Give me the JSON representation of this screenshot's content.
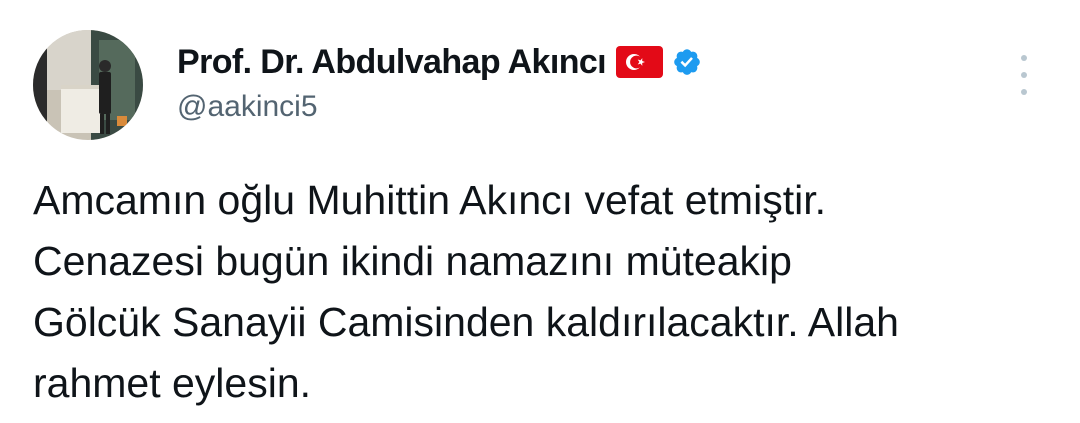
{
  "author": {
    "display_name": "Prof. Dr. Abdulvahap Akıncı",
    "handle": "@aakinci5",
    "flag_icon": "turkey-flag-icon",
    "verified_icon": "verified-badge-icon",
    "verified_color": "#1d9bf0",
    "flag_color": "#e30a17"
  },
  "menu": {
    "icon": "more-options-icon"
  },
  "tweet": {
    "lines": [
      "Amcamın oğlu Muhittin Akıncı vefat etmiştir.",
      "Cenazesi bugün ikindi namazını müteakip",
      "Gölcük Sanayii Camisinden kaldırılacaktır. Allah",
      "rahmet eylesin."
    ]
  },
  "colors": {
    "text": "#0f1419",
    "secondary_text": "#536471",
    "background": "#ffffff"
  }
}
